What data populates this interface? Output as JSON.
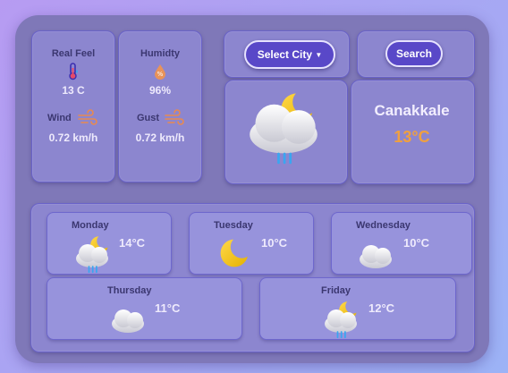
{
  "stats": {
    "real_feel": {
      "label": "Real Feel",
      "value": "13 C",
      "icon": "thermometer-icon"
    },
    "humidity": {
      "label": "Humidty",
      "value": "96%",
      "icon": "humidity-drop-icon"
    },
    "wind": {
      "label": "Wind",
      "value": "0.72 km/h",
      "icon": "wind-icon"
    },
    "gust": {
      "label": "Gust",
      "value": "0.72 km/h",
      "icon": "wind-icon"
    }
  },
  "controls": {
    "select_city_label": "Select City",
    "search_label": "Search"
  },
  "current": {
    "city": "Canakkale",
    "temp": "13°C",
    "icon": "moon-cloud-rain-icon"
  },
  "forecast": [
    {
      "day": "Monday",
      "temp": "14°C",
      "icon": "moon-cloud-rain-icon"
    },
    {
      "day": "Tuesday",
      "temp": "10°C",
      "icon": "crescent-moon-icon"
    },
    {
      "day": "Wednesday",
      "temp": "10°C",
      "icon": "cloud-icon"
    },
    {
      "day": "Thursday",
      "temp": "11°C",
      "icon": "cloud-icon"
    },
    {
      "day": "Friday",
      "temp": "12°C",
      "icon": "moon-cloud-rain-icon"
    }
  ],
  "colors": {
    "accent": "#5948c8",
    "temp_highlight": "#f0a040",
    "card": "#7f78b8",
    "panel": "#8c86cf"
  }
}
